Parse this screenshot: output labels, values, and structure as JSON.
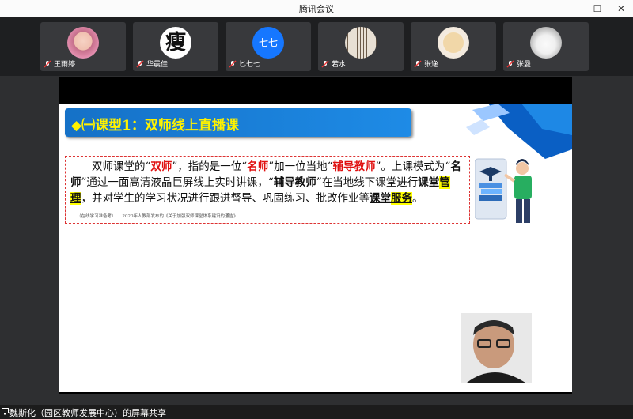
{
  "window": {
    "title": "腾讯会议",
    "controls": [
      "—",
      "☐",
      "✕"
    ]
  },
  "participants": [
    {
      "name": "王雨婷",
      "avatar": "photo-girl"
    },
    {
      "name": "华晨佳",
      "avatar": "char-avatar",
      "char": "瘦"
    },
    {
      "name": "匕七七",
      "avatar": "text-avatar",
      "text": "七七",
      "color": "#1677ff"
    },
    {
      "name": "若水",
      "avatar": "photo-trees"
    },
    {
      "name": "张逸",
      "avatar": "photo-cartoon"
    },
    {
      "name": "张曼",
      "avatar": "photo-dog"
    }
  ],
  "slide": {
    "heading": "◆㈠课型1：双师线上直播课",
    "p": {
      "t1": "双师课堂的“",
      "h1": "双师",
      "t2": "”，指的是一位“",
      "h2": "名师",
      "t3": "”加一位当地“",
      "h3": "辅导教师",
      "t4": "”。上课模式为“",
      "b1": "名师",
      "t5": "”通过一面高清液晶巨屏线上实时讲课，“",
      "b2": "辅导教师",
      "t6": "”在当地线下课堂进行",
      "u1": "课堂",
      "hl1": "管理",
      "t7": "，并对学生的学习状况进行跟进督导、巩固练习、批改作业等",
      "u2": "课堂",
      "hl2": "服务",
      "t8": "。",
      "src1": "（在线学习准备考）",
      "src2": "2020年人教部发布的《关于加强双师课堂体系建设的通告》"
    }
  },
  "share": {
    "text": "魏斯化（园区教师发展中心）的屏幕共享"
  }
}
